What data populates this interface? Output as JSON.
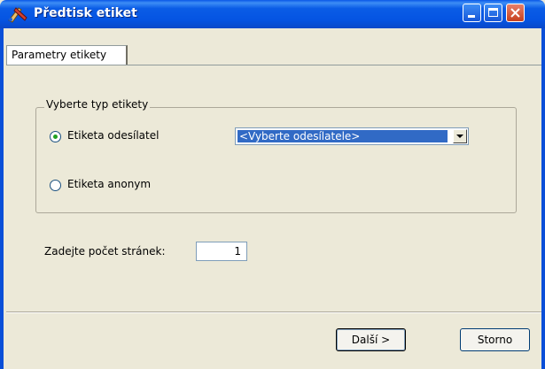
{
  "window": {
    "title": "Předtisk etiket",
    "app_icon": "label-print-icon",
    "controls": {
      "minimize": "minimize-icon",
      "maximize": "maximize-icon",
      "close": "close-icon"
    }
  },
  "tabs": [
    {
      "label": "Parametry etikety",
      "selected": true
    }
  ],
  "label_type": {
    "group_title": "Vyberte typ etikety",
    "options": [
      {
        "label": "Etiketa odesílatel",
        "checked": true
      },
      {
        "label": "Etiketa anonym",
        "checked": false
      }
    ],
    "sender_select": {
      "value": "<Vyberte odesílatele>"
    }
  },
  "page_count": {
    "label": "Zadejte počet stránek:",
    "value": "1"
  },
  "buttons": {
    "next": "Další >",
    "cancel": "Storno"
  },
  "colors": {
    "titlebar": "#0a5ce6",
    "dialog_bg": "#ece9d8",
    "selection": "#316ac5",
    "close_button": "#c6401e"
  }
}
